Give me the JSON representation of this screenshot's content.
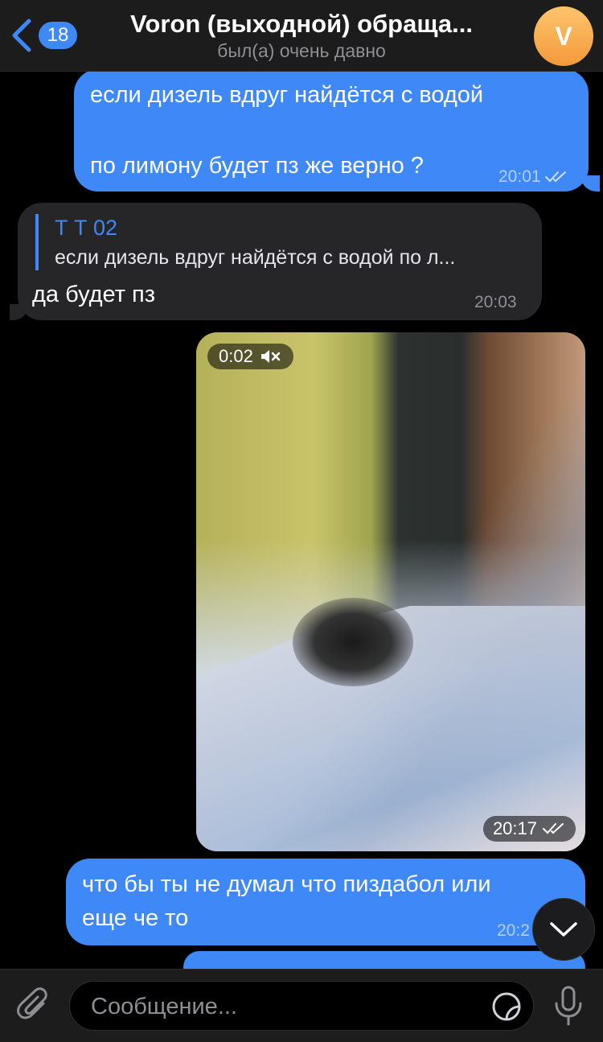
{
  "header": {
    "back_count": "18",
    "title": "Voron (выходной) обраща...",
    "status": "был(а) очень давно",
    "avatar_letter": "V",
    "avatar_color": "#f6ab4f"
  },
  "messages": [
    {
      "direction": "out",
      "line1": "если дизель вдруг найдётся с водой",
      "line2": "по лимону будет пз же верно ?",
      "time": "20:01",
      "read": true
    },
    {
      "direction": "in",
      "reply_name": "Т Т 02",
      "reply_text": "если дизель вдруг найдётся с водой  по л...",
      "text": "да будет пз",
      "time": "20:03"
    },
    {
      "direction": "out",
      "type": "video",
      "duration": "0:02",
      "muted_icon": "speaker-muted-icon",
      "time": "20:17",
      "read": true
    },
    {
      "direction": "out",
      "line1": "что бы ты не думал что пиздабол или",
      "line2": "еще че то",
      "time": "20:2"
    }
  ],
  "input": {
    "placeholder": "Сообщение..."
  },
  "colors": {
    "accent": "#3e88f7",
    "incoming_bubble": "#262628",
    "background": "#000000"
  },
  "icons": [
    "back-chevron-icon",
    "paperclip-icon",
    "sticker-icon",
    "microphone-icon",
    "chevron-down-icon",
    "double-check-icon"
  ]
}
